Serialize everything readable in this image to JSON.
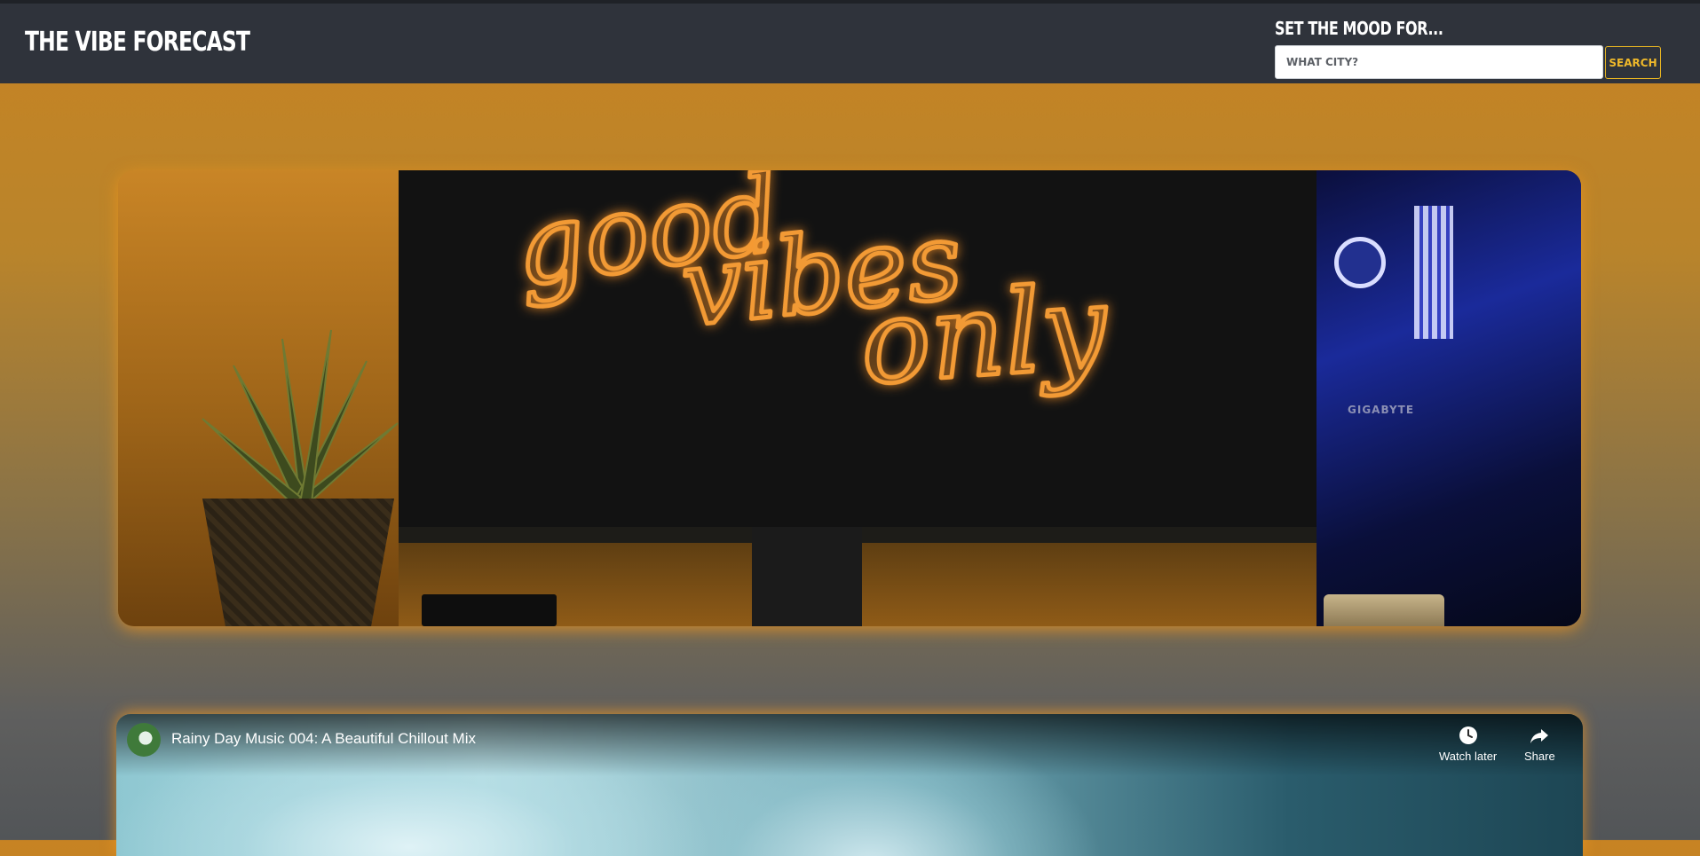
{
  "header": {
    "brand": "THE VIBE FORECAST",
    "mood_label": "SET THE MOOD FOR...",
    "search_placeholder": "WHAT CITY?",
    "search_button": "SEARCH"
  },
  "hero": {
    "neon_text": [
      "good",
      "vibes",
      "only"
    ],
    "pc_brand": "GIGABYTE"
  },
  "video": {
    "title": "Rainy Day Music 004: A Beautiful Chillout Mix",
    "controls": [
      {
        "label": "Watch later",
        "icon": "clock-icon"
      },
      {
        "label": "Share",
        "icon": "share-icon"
      }
    ]
  },
  "colors": {
    "navbar": "#2f333b",
    "accent": "#f0b92a",
    "neon": "#f29a35"
  }
}
